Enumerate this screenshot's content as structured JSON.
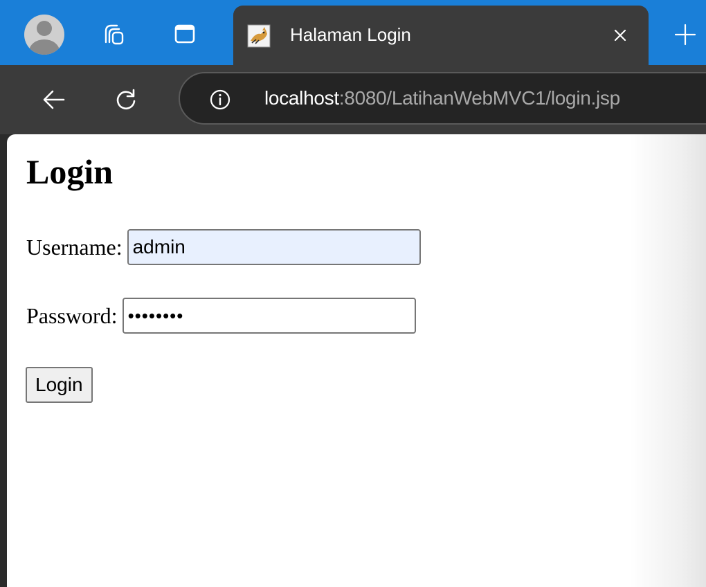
{
  "colors": {
    "tabstrip": "#1a7fd8",
    "toolbar": "#3b3b3b",
    "page_background": "#ffffff",
    "autofill_background": "#e8f0fe"
  },
  "browser": {
    "tab": {
      "title": "Halaman Login",
      "favicon": "tomcat-favicon-icon"
    },
    "address_bar": {
      "url_host": "localhost",
      "url_rest": ":8080/LatihanWebMVC1/login.jsp"
    },
    "icons": [
      "profile-avatar-icon",
      "workspaces-icon",
      "vertical-tabs-icon",
      "close-icon",
      "plus-icon",
      "back-arrow-icon",
      "reload-icon",
      "info-icon"
    ]
  },
  "page": {
    "heading": "Login",
    "form": {
      "username_label": "Username:",
      "username_value": "admin",
      "password_label": "Password:",
      "password_value": "••••••••",
      "submit_label": "Login"
    }
  }
}
